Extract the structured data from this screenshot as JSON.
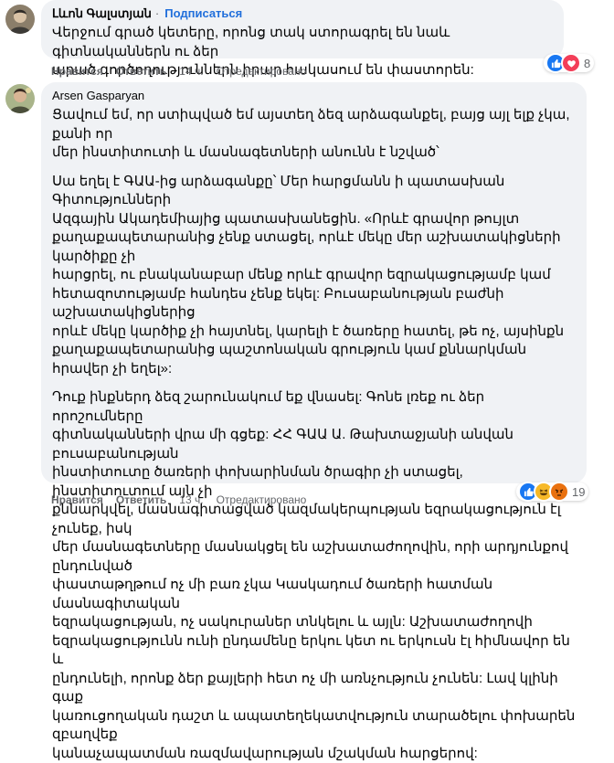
{
  "comments": [
    {
      "author": "Լևոն Գալստյան",
      "subscribe_label": "Подписаться",
      "paragraphs": [
        "Վերջում գրած կետերը, որոնց տակ ստորագրել են նաև գիտնականներն ու ձեր\nարած գործողություններն իրար հակասում են փաստորեն:"
      ],
      "like_label": "Нравится",
      "reply_label": "Ответить",
      "time": "14 ч.",
      "edited_label": "Отредактировано",
      "reaction_icons": [
        "like-icon",
        "love-icon"
      ],
      "reaction_count": "8"
    },
    {
      "author": "Arsen Gasparyan",
      "paragraphs": [
        "Ցավում եմ, որ ստիպված եմ այստեղ ձեզ արձագանքել, բայց այլ ելք չկա, քանի որ\nմեր ինստիտուտի և մասնագետների անունն է նշված՝",
        "Սա եղել է ԳԱԱ-ից արձագանքը՝ Մեր հարցմանն ի պատասխան Գիտությունների\nԱզգային Ակադեմիայից պատասխանեցին. «Որևէ գրավոր թույլտ\nքաղաքապետարանից չենք ստացել, որևէ մեկը մեր աշխատակիցների կարծիքը չի\nհարցրել, ու բնականաբար մենք որևէ գրավոր եզրակացությամբ կամ\nհետազոտությամբ հանդես չենք եկել: Բուսաբանության բաժնի աշխատակիցներից\nորևէ մեկը կարծիք չի հայտնել, կարելի է ծառերը հատել, թե ոչ, այսինքն\nքաղաքապետարանից պաշտոնական գրություն կամ քննարկման հրավեր չի եղել»:",
        "Դուք ինքներդ ձեզ շարունակում եք վնասել: Գոնե լռեք ու ձեր որոշումները\nգիտնականների վրա մի գցեք: ՀՀ ԳԱԱ Ա. Թախտաջյանի անվան բուսաբանության\nինստիտուտը ծառերի փոխարինման ծրագիր չի ստացել, ինստիտուտում այն չի\nքննարկվել, մասնագիտացված կազմակերպության եզրակացություն էլ չունեք, իսկ\nմեր մասնագետները մասնակցել են աշխատաժողովին, որի արդյունքով ընդունված\nփաստաթղթում ոչ մի բառ չկա Կասկադում ծառերի հատման մասնագիտական\nեզրակացության, ոչ սակուրաներ տնկելու և այլն: Աշխատաժողովի\nեզրակացությունն ունի ընդամենը երկու կետ ու երկուսն էլ հիմնավոր են և\nընդունելի, որոնք ձեր քայլերի հետ ոչ մի առնչություն չունեն: Լավ կլինի գաք\nկառուցողական դաշտ և ապատեղեկատվություն տարածելու փոխարեն զբաղվեք\nկանաչապատման ռազմավարության մշակման հարցերով:"
      ],
      "like_label": "Нравится",
      "reply_label": "Ответить",
      "time": "13 ч.",
      "edited_label": "Отредактировано",
      "reaction_icons": [
        "like-icon",
        "haha-icon",
        "angry-icon"
      ],
      "reaction_count": "19"
    }
  ],
  "colors": {
    "bubble": "#f0f2f5",
    "link_blue": "#216fdb",
    "meta_gray": "#65676b",
    "like_blue": "#1877f2",
    "love_red": "#f33e58",
    "haha_yellow": "#f7b928",
    "angry_orange": "#e9710f"
  }
}
